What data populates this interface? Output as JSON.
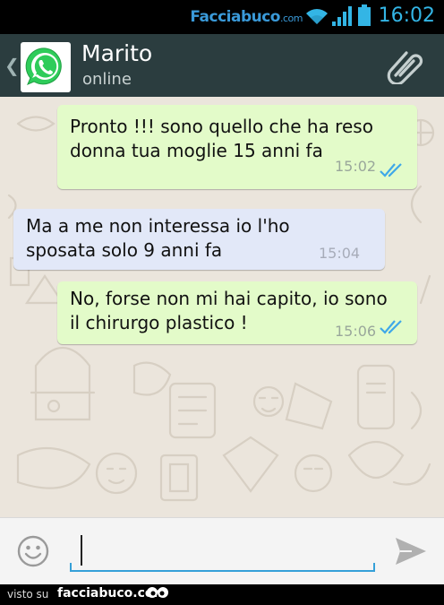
{
  "status_bar": {
    "watermark_brand": "Facciabuco",
    "watermark_suffix": ".com",
    "clock": "16:02",
    "icons": [
      "wifi-icon",
      "signal-icon",
      "battery-icon"
    ],
    "accent_color": "#33b5e5"
  },
  "header": {
    "back_icon": "chevron-left-icon",
    "avatar_icon": "whatsapp-logo",
    "contact_name": "Marito",
    "contact_status": "online",
    "attach_icon": "paperclip-icon",
    "background": "#2b3d3f"
  },
  "messages": [
    {
      "direction": "outgoing",
      "text": "Pronto !!! sono quello che ha reso\ndonna tua moglie 15 anni fa",
      "time": "15:02",
      "status": "read"
    },
    {
      "direction": "incoming",
      "text": "Ma a me non interessa io l'ho\nsposata solo 9 anni fa",
      "time": "15:04"
    },
    {
      "direction": "outgoing",
      "text": "No, forse non mi hai capito, io sono\nil chirurgo plastico !",
      "time": "15:06",
      "status": "read"
    }
  ],
  "input_bar": {
    "emoji_icon": "smiley-icon",
    "value": "",
    "send_icon": "send-icon"
  },
  "footer": {
    "prefix": "visto su",
    "brand": "facciabuco.com"
  },
  "colors": {
    "outgoing_bubble": "#e3fbc9",
    "incoming_bubble": "#e2e8f8",
    "chat_background": "#ebe5dc",
    "read_ticks": "#3fa8e8"
  }
}
